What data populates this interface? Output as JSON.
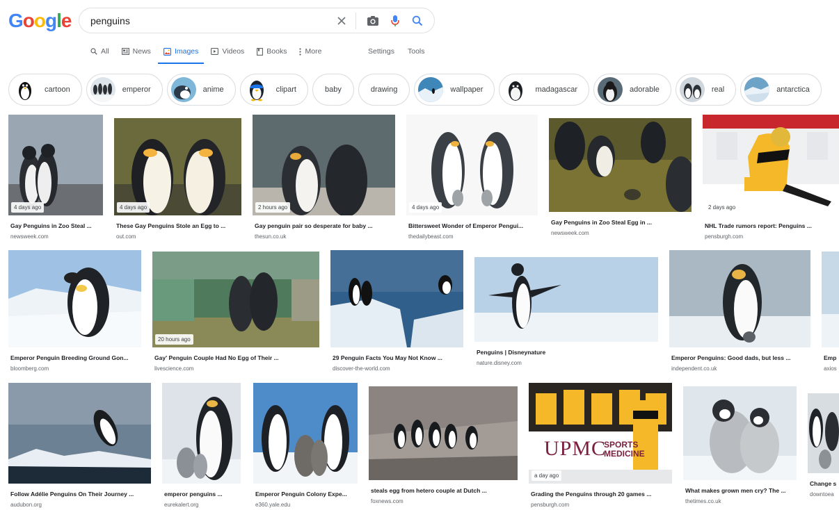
{
  "logo": {
    "text": "Google",
    "letters": [
      "G",
      "o",
      "o",
      "g",
      "l",
      "e"
    ],
    "colors": [
      "#4285f4",
      "#ea4335",
      "#fbbc05",
      "#4285f4",
      "#34a853",
      "#ea4335"
    ]
  },
  "search": {
    "value": "penguins",
    "placeholder": ""
  },
  "tabs": [
    {
      "label": "All",
      "icon": "search-icon",
      "active": false
    },
    {
      "label": "News",
      "icon": "news-icon",
      "active": false
    },
    {
      "label": "Images",
      "icon": "image-icon",
      "active": true
    },
    {
      "label": "Videos",
      "icon": "video-icon",
      "active": false
    },
    {
      "label": "Books",
      "icon": "book-icon",
      "active": false
    },
    {
      "label": "More",
      "icon": "more-vert-icon",
      "active": false
    }
  ],
  "tools": {
    "settings": "Settings",
    "tools": "Tools"
  },
  "chips": [
    {
      "label": "cartoon",
      "thumb": true
    },
    {
      "label": "emperor",
      "thumb": true
    },
    {
      "label": "anime",
      "thumb": true
    },
    {
      "label": "clipart",
      "thumb": true
    },
    {
      "label": "baby",
      "thumb": false
    },
    {
      "label": "drawing",
      "thumb": false
    },
    {
      "label": "wallpaper",
      "thumb": true
    },
    {
      "label": "madagascar",
      "thumb": true
    },
    {
      "label": "adorable",
      "thumb": true
    },
    {
      "label": "real",
      "thumb": true
    },
    {
      "label": "antarctica",
      "thumb": true
    }
  ],
  "results": [
    {
      "caption": "Gay Penguins in Zoo Steal ...",
      "source": "newsweek.com",
      "badge": "4 days ago"
    },
    {
      "caption": "These Gay Penguins Stole an Egg to ...",
      "source": "out.com",
      "badge": "4 days ago"
    },
    {
      "caption": "Gay penguin pair so desperate for baby ...",
      "source": "thesun.co.uk",
      "badge": "2 hours ago"
    },
    {
      "caption": "Bittersweet Wonder of Emperor Pengui...",
      "source": "thedailybeast.com",
      "badge": "4 days ago"
    },
    {
      "caption": "Gay Penguins in Zoo Steal Egg in ...",
      "source": "newsweek.com",
      "badge": ""
    },
    {
      "caption": "NHL Trade rumors report: Penguins ...",
      "source": "pensburgh.com",
      "badge": "2 days ago"
    },
    {
      "caption": "Emperor Penguin Breeding Ground Gon...",
      "source": "bloomberg.com",
      "badge": ""
    },
    {
      "caption": "Gay' Penguin Couple Had No Egg of Their ...",
      "source": "livescience.com",
      "badge": "20 hours ago"
    },
    {
      "caption": "29 Penguin Facts You May Not Know ...",
      "source": "discover-the-world.com",
      "badge": ""
    },
    {
      "caption": "Penguins | Disneynature",
      "source": "nature.disney.com",
      "badge": ""
    },
    {
      "caption": "Emperor Penguins: Good dads, but less ...",
      "source": "independent.co.uk",
      "badge": ""
    },
    {
      "caption": "Emp",
      "source": "axios",
      "badge": ""
    },
    {
      "caption": "Follow Adélie Penguins On Their Journey ...",
      "source": "audubon.org",
      "badge": ""
    },
    {
      "caption": "emperor penguins ...",
      "source": "eurekalert.org",
      "badge": ""
    },
    {
      "caption": "Emperor Penguin Colony Expe...",
      "source": "e360.yale.edu",
      "badge": ""
    },
    {
      "caption": "steals egg from hetero couple at Dutch ...",
      "source": "foxnews.com",
      "badge": ""
    },
    {
      "caption": "Grading the Penguins through 20 games ...",
      "source": "pensburgh.com",
      "badge": "a day ago",
      "sign_main": "UPMC",
      "sign_sub1": "SPORTS",
      "sign_sub2": "MEDICINE"
    },
    {
      "caption": "What makes grown men cry? The ...",
      "source": "thetimes.co.uk",
      "badge": ""
    },
    {
      "caption": "Change s",
      "source": "downtoea",
      "badge": ""
    }
  ],
  "colors": {
    "accent": "#1a73e8",
    "text": "#202124",
    "muted": "#5f6368",
    "border": "#dadce0"
  }
}
